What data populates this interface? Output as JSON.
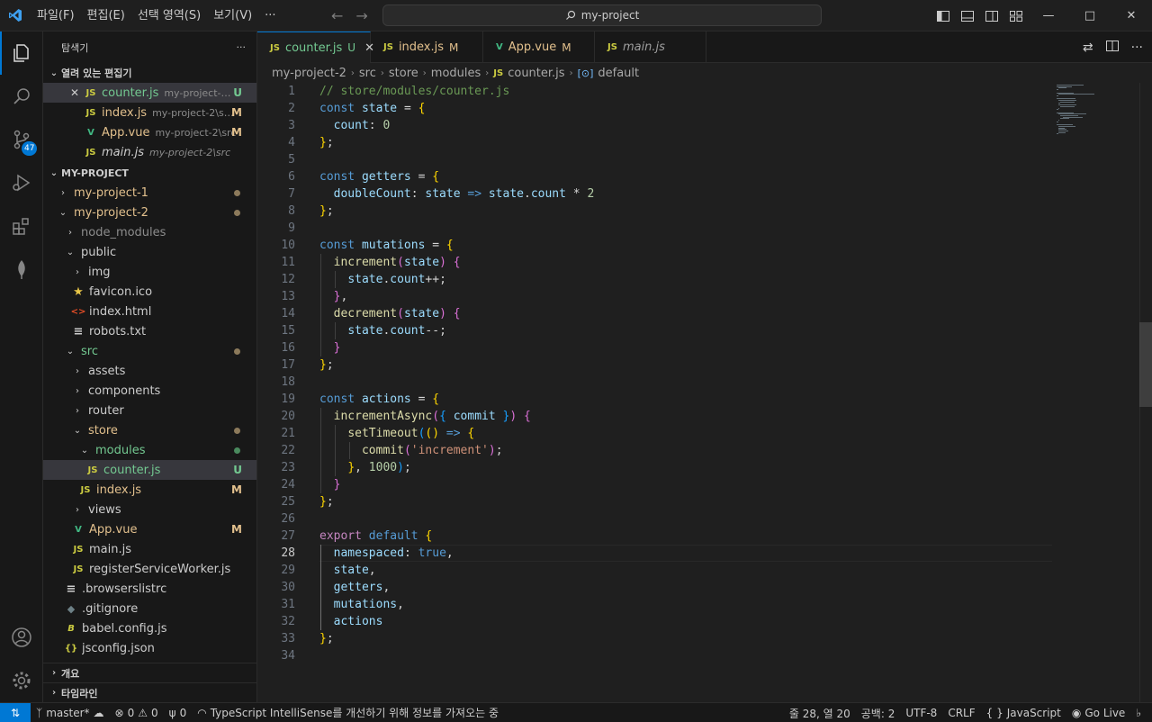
{
  "titlebar": {
    "menu": [
      "파일(F)",
      "편집(E)",
      "선택 영역(S)",
      "보기(V)",
      "···"
    ],
    "search": "my-project"
  },
  "activity": {
    "scm_badge": "47"
  },
  "sidebar": {
    "title": "탐색기",
    "open_editors": {
      "label": "열려 있는 편집기",
      "items": [
        {
          "name": "counter.js",
          "desc": "my-project-2...",
          "status": "U"
        },
        {
          "name": "index.js",
          "desc": "my-project-2\\sr...",
          "status": "M"
        },
        {
          "name": "App.vue",
          "desc": "my-project-2\\src",
          "status": "M"
        },
        {
          "name": "main.js",
          "desc": "my-project-2\\src",
          "status": ""
        }
      ]
    },
    "project": {
      "label": "MY-PROJECT",
      "tree": [
        {
          "label": "my-project-1"
        },
        {
          "label": "my-project-2"
        },
        {
          "label": "node_modules"
        },
        {
          "label": "public"
        },
        {
          "label": "img"
        },
        {
          "label": "favicon.ico"
        },
        {
          "label": "index.html"
        },
        {
          "label": "robots.txt"
        },
        {
          "label": "src"
        },
        {
          "label": "assets"
        },
        {
          "label": "components"
        },
        {
          "label": "router"
        },
        {
          "label": "store"
        },
        {
          "label": "modules"
        },
        {
          "label": "counter.js",
          "status": "U"
        },
        {
          "label": "index.js",
          "status": "M"
        },
        {
          "label": "views"
        },
        {
          "label": "App.vue",
          "status": "M"
        },
        {
          "label": "main.js"
        },
        {
          "label": "registerServiceWorker.js"
        },
        {
          "label": ".browserslistrc"
        },
        {
          "label": ".gitignore"
        },
        {
          "label": "babel.config.js"
        },
        {
          "label": "jsconfig.json"
        }
      ]
    },
    "outline": "개요",
    "timeline": "타임라인"
  },
  "tabs": [
    {
      "label": "counter.js",
      "mark": "U",
      "icon": "JS"
    },
    {
      "label": "index.js",
      "mark": "M",
      "icon": "JS"
    },
    {
      "label": "App.vue",
      "mark": "M",
      "icon": "V"
    },
    {
      "label": "main.js",
      "mark": "",
      "icon": "JS"
    }
  ],
  "breadcrumb": [
    "my-project-2",
    "src",
    "store",
    "modules",
    "counter.js",
    "default"
  ],
  "editor": {
    "current_line": 28,
    "lines": [
      "// store/modules/counter.js",
      "const state = {",
      "  count: 0",
      "};",
      "",
      "const getters = {",
      "  doubleCount: state => state.count * 2",
      "};",
      "",
      "const mutations = {",
      "  increment(state) {",
      "    state.count++;",
      "  },",
      "  decrement(state) {",
      "    state.count--;",
      "  }",
      "};",
      "",
      "const actions = {",
      "  incrementAsync({ commit }) {",
      "    setTimeout(() => {",
      "      commit('increment');",
      "    }, 1000);",
      "  }",
      "};",
      "",
      "export default {",
      "  namespaced: true,",
      "  state,",
      "  getters,",
      "  mutations,",
      "  actions",
      "};",
      ""
    ]
  },
  "statusbar": {
    "branch": "master*",
    "errors": "0",
    "warnings": "0",
    "ports": "0",
    "message": "TypeScript IntelliSense를 개선하기 위해 정보를 가져오는 중",
    "position": "줄 28, 열 20",
    "spaces": "공백: 2",
    "encoding": "UTF-8",
    "eol": "CRLF",
    "language": "JavaScript",
    "golive": "Go Live"
  }
}
